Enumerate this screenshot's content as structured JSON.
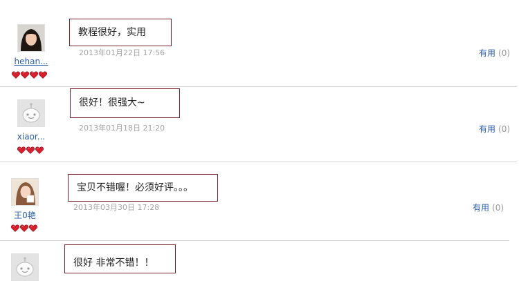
{
  "reviews": [
    {
      "username": "hehan...",
      "hearts": 4,
      "avatar": "photo-avatar-girl",
      "comment": "教程很好，实用",
      "date": "2013年01月22日 17:56",
      "useful_label": "有用",
      "useful_count": "(0)"
    },
    {
      "username": "xiaor...",
      "hearts": 3,
      "avatar": "default-avatar",
      "comment": "很好！很强大~",
      "date": "2013年01月18日 21:20",
      "useful_label": "有用",
      "useful_count": "(0)"
    },
    {
      "username": "王0艳",
      "hearts": 3,
      "avatar": "photo-avatar-girl-2",
      "comment": "宝贝不错喔！必须好评。。。",
      "date": "2013年03月30日 17:28",
      "useful_label": "有用",
      "useful_count": "(0)"
    },
    {
      "username": "",
      "hearts": 0,
      "avatar": "default-avatar",
      "comment": "很好 非常不错！！",
      "date": "",
      "useful_label": "",
      "useful_count": ""
    }
  ],
  "colors": {
    "bubble_border": "#7a1f2b",
    "link": "#2a5da8",
    "date": "#a3a3a3",
    "heart": "#d8202c"
  }
}
